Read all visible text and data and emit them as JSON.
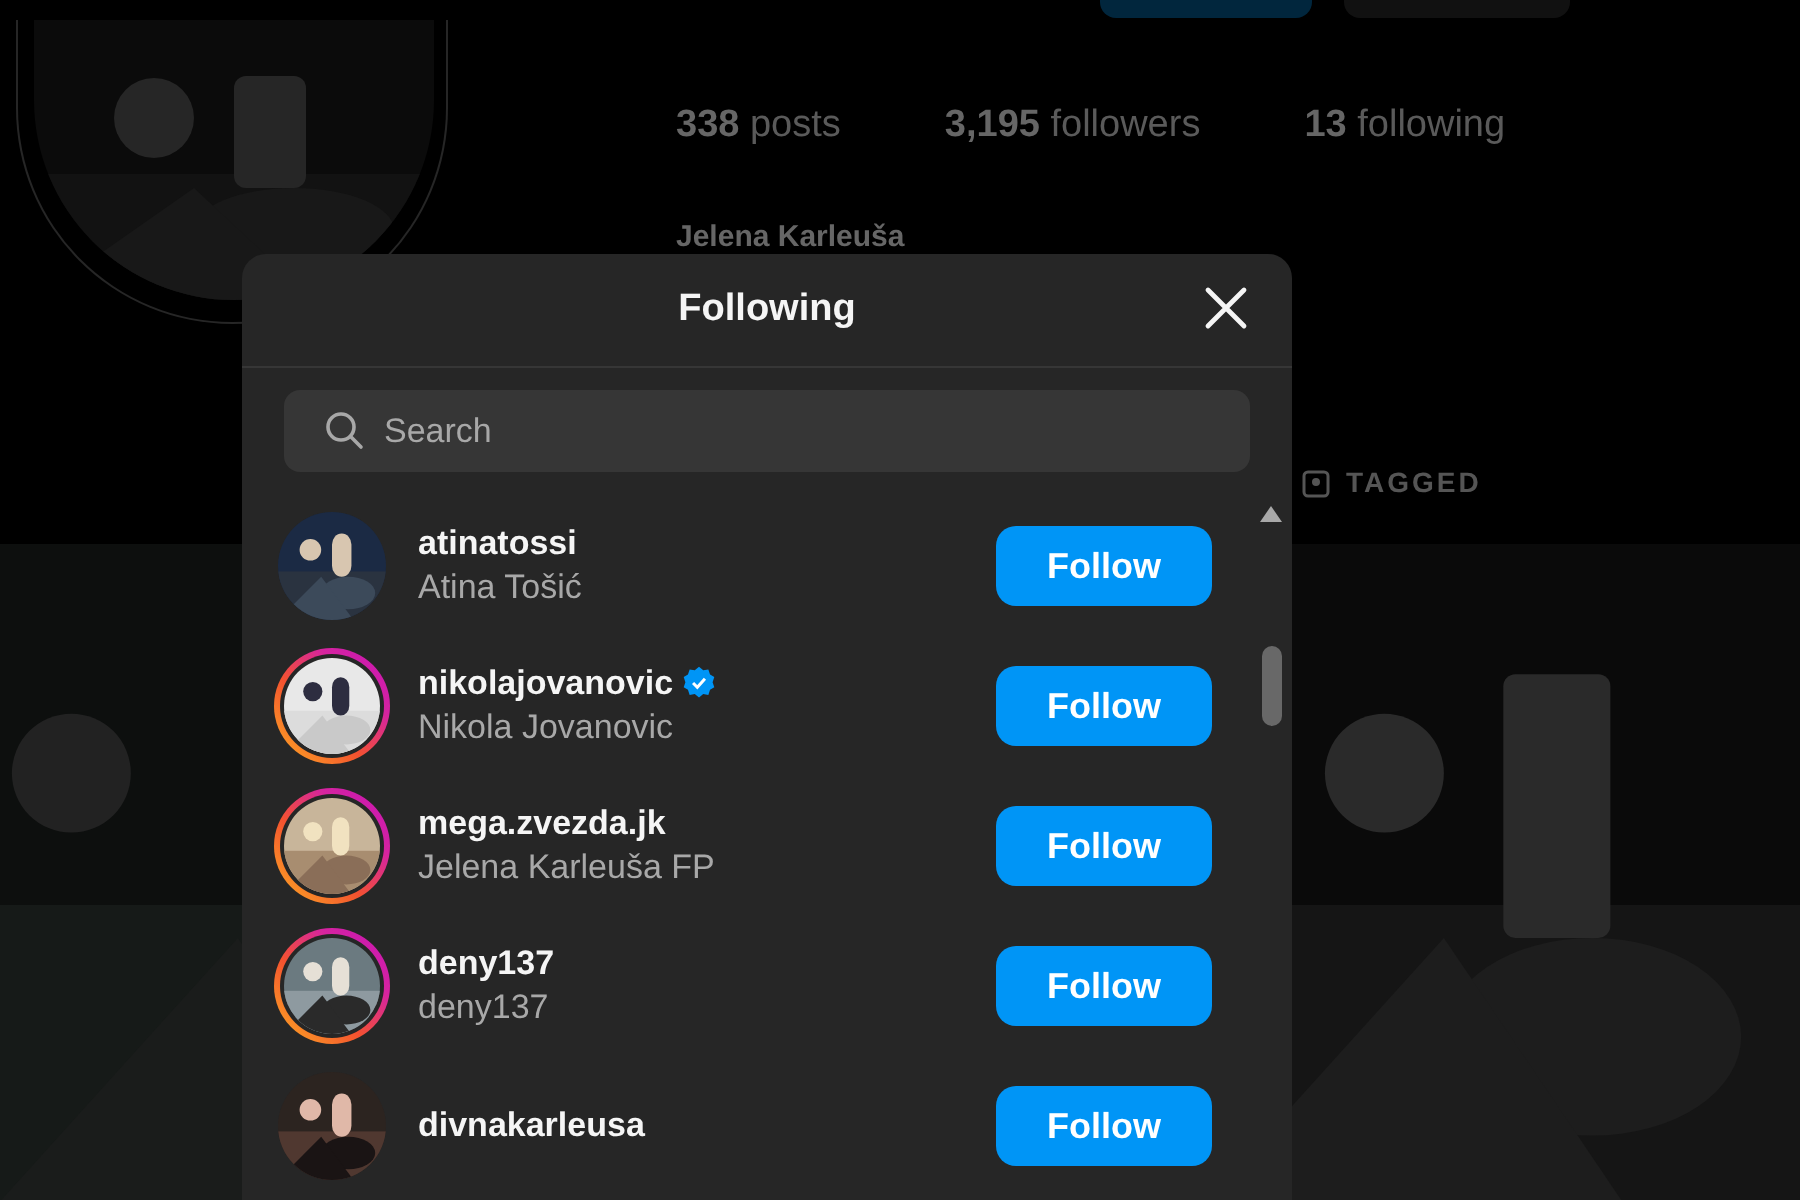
{
  "profile": {
    "stats": [
      {
        "count": "338",
        "label": "posts"
      },
      {
        "count": "3,195",
        "label": "followers"
      },
      {
        "count": "13",
        "label": "following"
      }
    ],
    "name": "Jelena Karleuša",
    "tabs": [
      {
        "label": "TAGGED",
        "selected": false
      }
    ]
  },
  "modal": {
    "title": "Following",
    "search": {
      "placeholder": "Search"
    },
    "users": [
      {
        "username": "atinatossi",
        "full_name": "Atina Tošić",
        "verified": false,
        "story_ring": false,
        "button": "Follow"
      },
      {
        "username": "nikolajovanovic",
        "full_name": "Nikola Jovanovic",
        "verified": true,
        "story_ring": true,
        "button": "Follow"
      },
      {
        "username": "mega.zvezda.jk",
        "full_name": "Jelena Karleuša FP",
        "verified": false,
        "story_ring": true,
        "button": "Follow"
      },
      {
        "username": "deny137",
        "full_name": "deny137",
        "verified": false,
        "story_ring": true,
        "button": "Follow"
      },
      {
        "username": "divnakarleusa",
        "verified": false,
        "story_ring": false,
        "button": "Follow"
      }
    ]
  }
}
